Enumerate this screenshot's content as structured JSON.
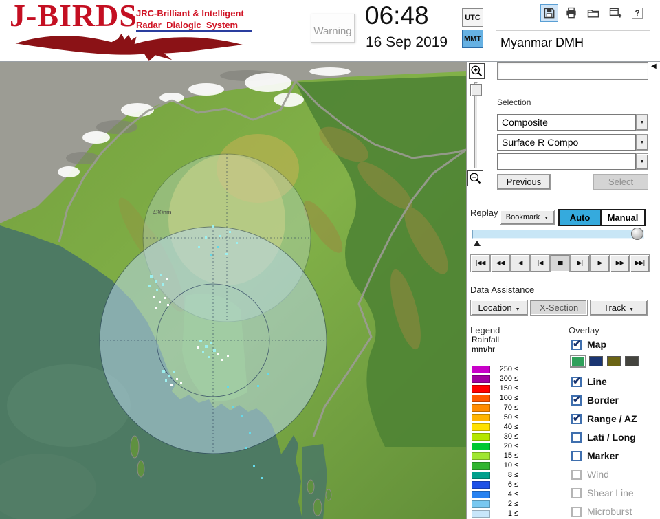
{
  "header": {
    "brand": {
      "title": "J-BIRDS",
      "tagline1": "JRC-Brilliant & Intelligent",
      "tagline2": "Radar  Dialogic  System"
    },
    "warning_label": "Warning",
    "time": "06:48",
    "date": "16 Sep 2019",
    "utc_label": "UTC",
    "mmt_label": "MMT",
    "mmt_selected": true,
    "utc_selected": false,
    "station_title": "Myanmar DMH",
    "save_selected": true
  },
  "icons": {
    "toolbar": [
      "save-icon",
      "print-icon",
      "open-folder-icon",
      "add-window-icon",
      "help-icon"
    ],
    "map": [
      "zoom-in-icon",
      "zoom-out-icon"
    ],
    "input": "scroll-left-icon"
  },
  "map": {
    "range_label": "430nm"
  },
  "selection": {
    "label": "Selection",
    "dropdown1": "Composite",
    "dropdown2": "Surface R Compo",
    "dropdown3": "",
    "previous_button": "Previous",
    "select_button": "Select",
    "select_enabled": false
  },
  "replay": {
    "label": "Replay",
    "bookmark_button": "Bookmark",
    "auto_button": "Auto",
    "manual_button": "Manual",
    "auto_selected": true,
    "stop_pressed": true,
    "playback": [
      "|◀◀",
      "◀◀",
      "◀",
      "|◀",
      "■",
      "▶|",
      "▶",
      "▶▶",
      "▶▶|"
    ]
  },
  "data_assistance": {
    "label": "Data Assistance",
    "location": "Location",
    "xsection": "X-Section",
    "track": "Track",
    "xsection_pressed": true
  },
  "legend": {
    "label": "Legend",
    "unit_line1": "Rainfall",
    "unit_line2": "mm/hr",
    "operator": "≤",
    "rows": [
      {
        "value": "250",
        "color": "#C800C8"
      },
      {
        "value": "200",
        "color": "#A000A0"
      },
      {
        "value": "150",
        "color": "#FF0000"
      },
      {
        "value": "100",
        "color": "#FF5A00"
      },
      {
        "value": "70",
        "color": "#FF8C00"
      },
      {
        "value": "50",
        "color": "#FFB400"
      },
      {
        "value": "40",
        "color": "#FFE100"
      },
      {
        "value": "30",
        "color": "#B4E600"
      },
      {
        "value": "20",
        "color": "#00C832"
      },
      {
        "value": "15",
        "color": "#A0E632"
      },
      {
        "value": "10",
        "color": "#32B432"
      },
      {
        "value": "8",
        "color": "#00A08C"
      },
      {
        "value": "6",
        "color": "#1E50E6"
      },
      {
        "value": "4",
        "color": "#2882F0"
      },
      {
        "value": "2",
        "color": "#78C8F0"
      },
      {
        "value": "1",
        "color": "#C8E6FA"
      }
    ]
  },
  "overlay": {
    "label": "Overlay",
    "swatches": [
      "#2FA05A",
      "#1A3572",
      "#6B6414",
      "#44443E"
    ],
    "items": [
      {
        "label": "Map",
        "checked": true,
        "enabled": true
      },
      {
        "label": "Line",
        "checked": true,
        "enabled": true
      },
      {
        "label": "Border",
        "checked": true,
        "enabled": true
      },
      {
        "label": "Range / AZ",
        "checked": true,
        "enabled": true
      },
      {
        "label": "Lati / Long",
        "checked": false,
        "enabled": true
      },
      {
        "label": "Marker",
        "checked": false,
        "enabled": true
      },
      {
        "label": "Wind",
        "checked": false,
        "enabled": false
      },
      {
        "label": "Shear Line",
        "checked": false,
        "enabled": false
      },
      {
        "label": "Microburst",
        "checked": false,
        "enabled": false
      }
    ]
  }
}
